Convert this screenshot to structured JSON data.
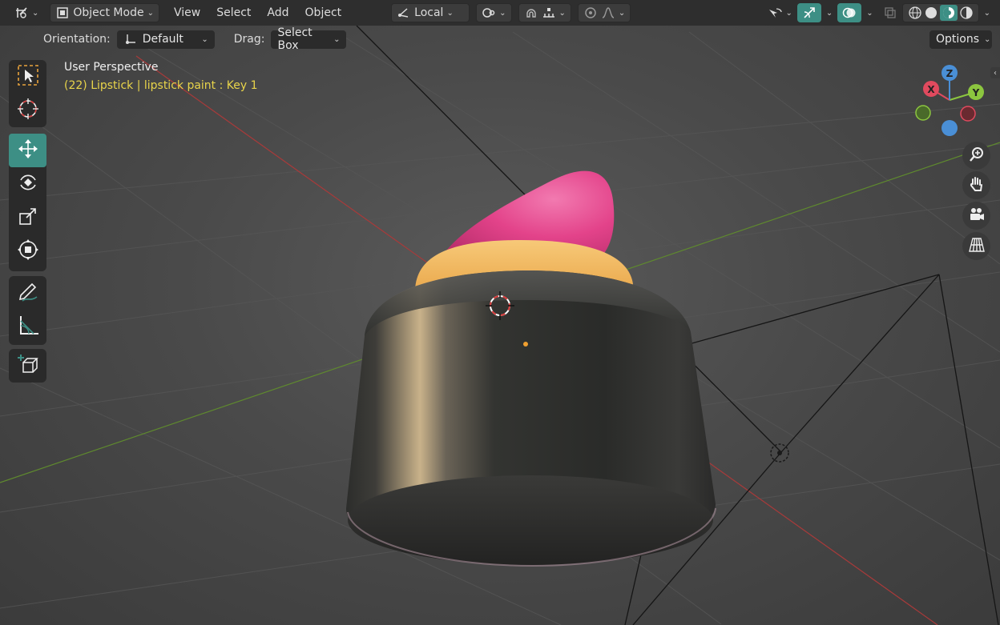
{
  "header": {
    "mode": "Object Mode",
    "menus": [
      "View",
      "Select",
      "Add",
      "Object"
    ],
    "transform_space": "Local"
  },
  "tool_settings": {
    "orientation_label": "Orientation:",
    "orientation_value": "Default",
    "drag_label": "Drag:",
    "drag_value": "Select Box",
    "options_label": "Options"
  },
  "overlay": {
    "perspective": "User Perspective",
    "object_info": "(22) Lipstick | lipstick paint : Key 1"
  },
  "gizmo": {
    "x_label": "X",
    "y_label": "Y",
    "z_label": "Z"
  },
  "toolbar": {
    "items": [
      "select-box",
      "cursor",
      "move",
      "rotate",
      "scale",
      "transform",
      "annotate",
      "measure",
      "add-cube"
    ],
    "active": "move"
  },
  "colors": {
    "accent": "#3d8f85",
    "x_axis": "#e04a5e",
    "y_axis": "#8cc63f",
    "z_axis": "#4a8fd6",
    "object_info": "#e8d44a",
    "lipstick_bullet": "#e23f86",
    "lipstick_ring": "#f2b457",
    "lipstick_case": "#2d2e2c"
  }
}
